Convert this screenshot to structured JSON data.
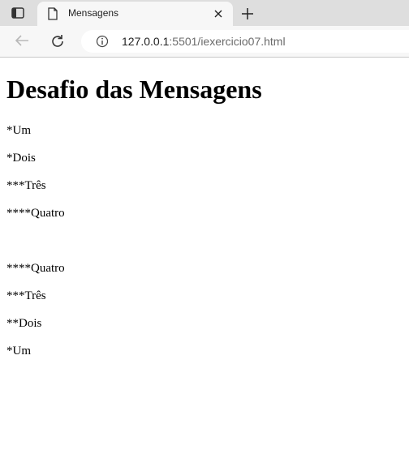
{
  "browser": {
    "tab_title": "Mensagens",
    "url_host": "127.0.0.1",
    "url_rest": ":5501/iexercicio07.html"
  },
  "page": {
    "heading": "Desafio das Mensagens",
    "first_list": [
      "*Um",
      "*Dois",
      "***Três",
      "****Quatro"
    ],
    "second_list": [
      "****Quatro",
      "***Três",
      "**Dois",
      "*Um"
    ]
  }
}
